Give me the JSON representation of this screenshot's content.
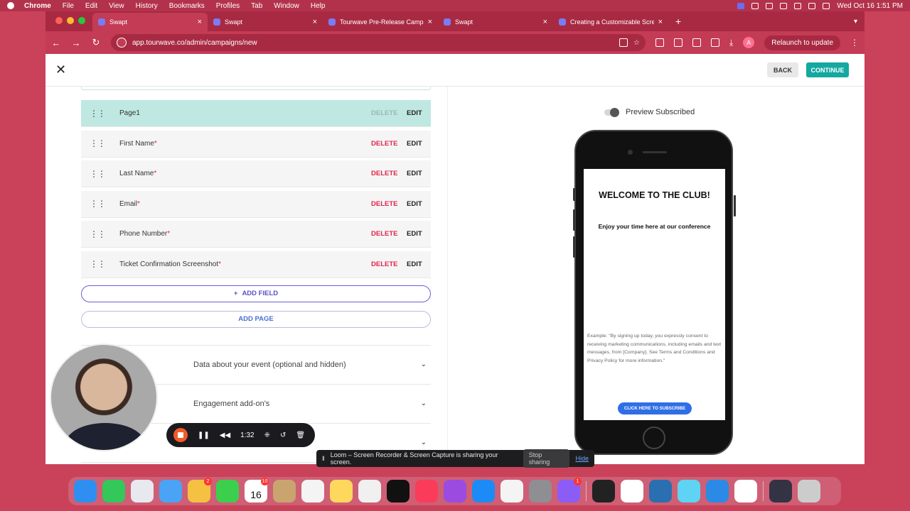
{
  "menubar": {
    "app": "Chrome",
    "items": [
      "File",
      "Edit",
      "View",
      "History",
      "Bookmarks",
      "Profiles",
      "Tab",
      "Window",
      "Help"
    ],
    "clock": "Wed Oct 16  1:51 PM"
  },
  "tabs": [
    {
      "title": "Swapt",
      "active": true
    },
    {
      "title": "Swapt",
      "active": false
    },
    {
      "title": "Tourwave Pre-Release Campa",
      "active": false
    },
    {
      "title": "Swapt",
      "active": false
    },
    {
      "title": "Creating a Customizable Scre",
      "active": false
    }
  ],
  "addressbar": {
    "url": "app.tourwave.co/admin/campaigns/new",
    "profile_initial": "A",
    "relaunch_label": "Relaunch to update"
  },
  "topbar": {
    "back_label": "BACK",
    "continue_label": "CONTINUE"
  },
  "fields": [
    {
      "name": "Page1",
      "required": false,
      "highlight": true,
      "delete_disabled": true
    },
    {
      "name": "First Name",
      "required": true,
      "highlight": false,
      "delete_disabled": false
    },
    {
      "name": "Last Name",
      "required": true,
      "highlight": false,
      "delete_disabled": false
    },
    {
      "name": "Email",
      "required": true,
      "highlight": false,
      "delete_disabled": false
    },
    {
      "name": "Phone Number",
      "required": true,
      "highlight": false,
      "delete_disabled": false
    },
    {
      "name": "Ticket Confirmation Screenshot",
      "required": true,
      "highlight": false,
      "delete_disabled": false
    }
  ],
  "field_actions": {
    "delete_label": "DELETE",
    "edit_label": "EDIT",
    "required_mark": "*"
  },
  "add_field_label": "ADD FIELD",
  "add_page_label": "ADD PAGE",
  "accordions": [
    {
      "label": "Data about your event (optional and hidden)"
    },
    {
      "label": "Engagement add-on's"
    },
    {
      "label": ""
    }
  ],
  "preview": {
    "toggle_label": "Preview Subscribed",
    "heading": "WELCOME TO THE CLUB!",
    "subheading": "Enjoy your time here at our conference",
    "consent": "Example: \"By signing up today, you expressly consent to receiving marketing communications, including emails and text messages, from [Company]. See Terms and Conditions and Privacy Policy for more information.\"",
    "button_label": "CLICK HERE TO SUBSCRIBE"
  },
  "loom": {
    "timer": "1:32",
    "share_message": "Loom – Screen Recorder & Screen Capture is sharing your screen.",
    "stop_label": "Stop sharing",
    "hide_label": "Hide"
  },
  "dock": {
    "calendar_day": "16",
    "calendar_month": "OCT",
    "badges": {
      "photos": "2",
      "calendar": "10",
      "feedback": "1"
    }
  },
  "colors": {
    "accent": "#13a8a0",
    "danger": "#e0264b",
    "link": "#4a6fd6",
    "browser": "#c33b55"
  }
}
